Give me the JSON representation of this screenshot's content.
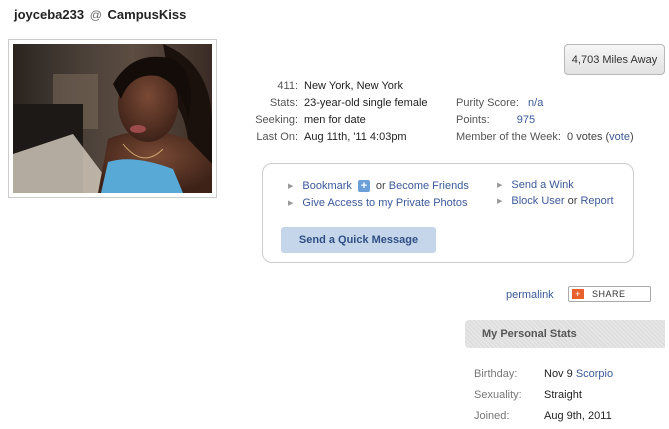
{
  "header": {
    "username": "joyceba233",
    "at": "@",
    "site": "CampusKiss"
  },
  "distance": "4,703 Miles Away",
  "profile": {
    "rows": [
      {
        "label": "411:",
        "value": "New York, New York"
      },
      {
        "label": "Stats:",
        "value": "23-year-old single female"
      },
      {
        "label": "Seeking:",
        "value": "men for date"
      },
      {
        "label": "Last On:",
        "value": "Aug 11th, '11 4:03pm"
      }
    ],
    "purity": {
      "label": "Purity Score:",
      "value": "n/a"
    },
    "points": {
      "label": "Points:",
      "value": "975"
    },
    "motw": {
      "label": "Member of the Week:",
      "value": "0 votes",
      "open": "(",
      "link": "vote",
      "close": ")"
    }
  },
  "actions": {
    "bookmark": "Bookmark",
    "plus": "+",
    "or1": "or",
    "become_friends": "Become Friends",
    "give_access": "Give Access to my Private Photos",
    "send_wink": "Send a Wink",
    "block_user": "Block User",
    "or2": "or",
    "report": "Report",
    "quick_message": "Send a Quick Message"
  },
  "permalink": "permalink",
  "share": "SHARE",
  "personal_stats": {
    "title": "My Personal Stats",
    "birthday": {
      "label": "Birthday:",
      "value": "Nov 9",
      "sign": "Scorpio"
    },
    "sexuality": {
      "label": "Sexuality:",
      "value": "Straight"
    },
    "joined": {
      "label": "Joined:",
      "value": "Aug 9th, 2011"
    }
  },
  "colors": {
    "link": "#3b5998",
    "button_bg": "#c6d6ea",
    "share_icon": "#e8612c",
    "stats_header_bg": "#dedede"
  }
}
